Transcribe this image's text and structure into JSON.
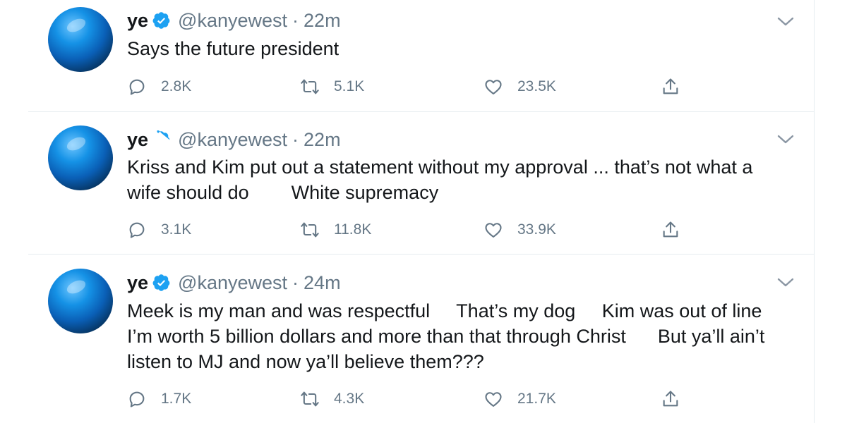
{
  "tweets": [
    {
      "name": "ye",
      "handle": "@kanyewest",
      "separator": "·",
      "time": "22m",
      "text": "Says the future president",
      "replies": "2.8K",
      "retweets": "5.1K",
      "likes": "23.5K"
    },
    {
      "name": "ye",
      "handle": "@kanyewest",
      "separator": "·",
      "time": "22m",
      "text": "Kriss and Kim put out a statement without my approval ... that’s not what a\nwife should do        White supremacy",
      "replies": "3.1K",
      "retweets": "11.8K",
      "likes": "33.9K"
    },
    {
      "name": "ye",
      "handle": "@kanyewest",
      "separator": "·",
      "time": "24m",
      "text": "Meek is my man and was respectful     That’s my dog     Kim was out of line\nI’m worth 5 billion dollars and more than that through Christ      But ya’ll ain’t\nlisten to MJ and now ya’ll believe them???",
      "replies": "1.7K",
      "retweets": "4.3K",
      "likes": "21.7K"
    }
  ],
  "colors": {
    "verified": "#1da1f2",
    "secondary_text": "#657786",
    "divider": "#e6ecf0"
  },
  "icons": [
    "verified-badge-icon",
    "chevron-down-icon",
    "reply-icon",
    "retweet-icon",
    "like-icon",
    "share-icon"
  ]
}
